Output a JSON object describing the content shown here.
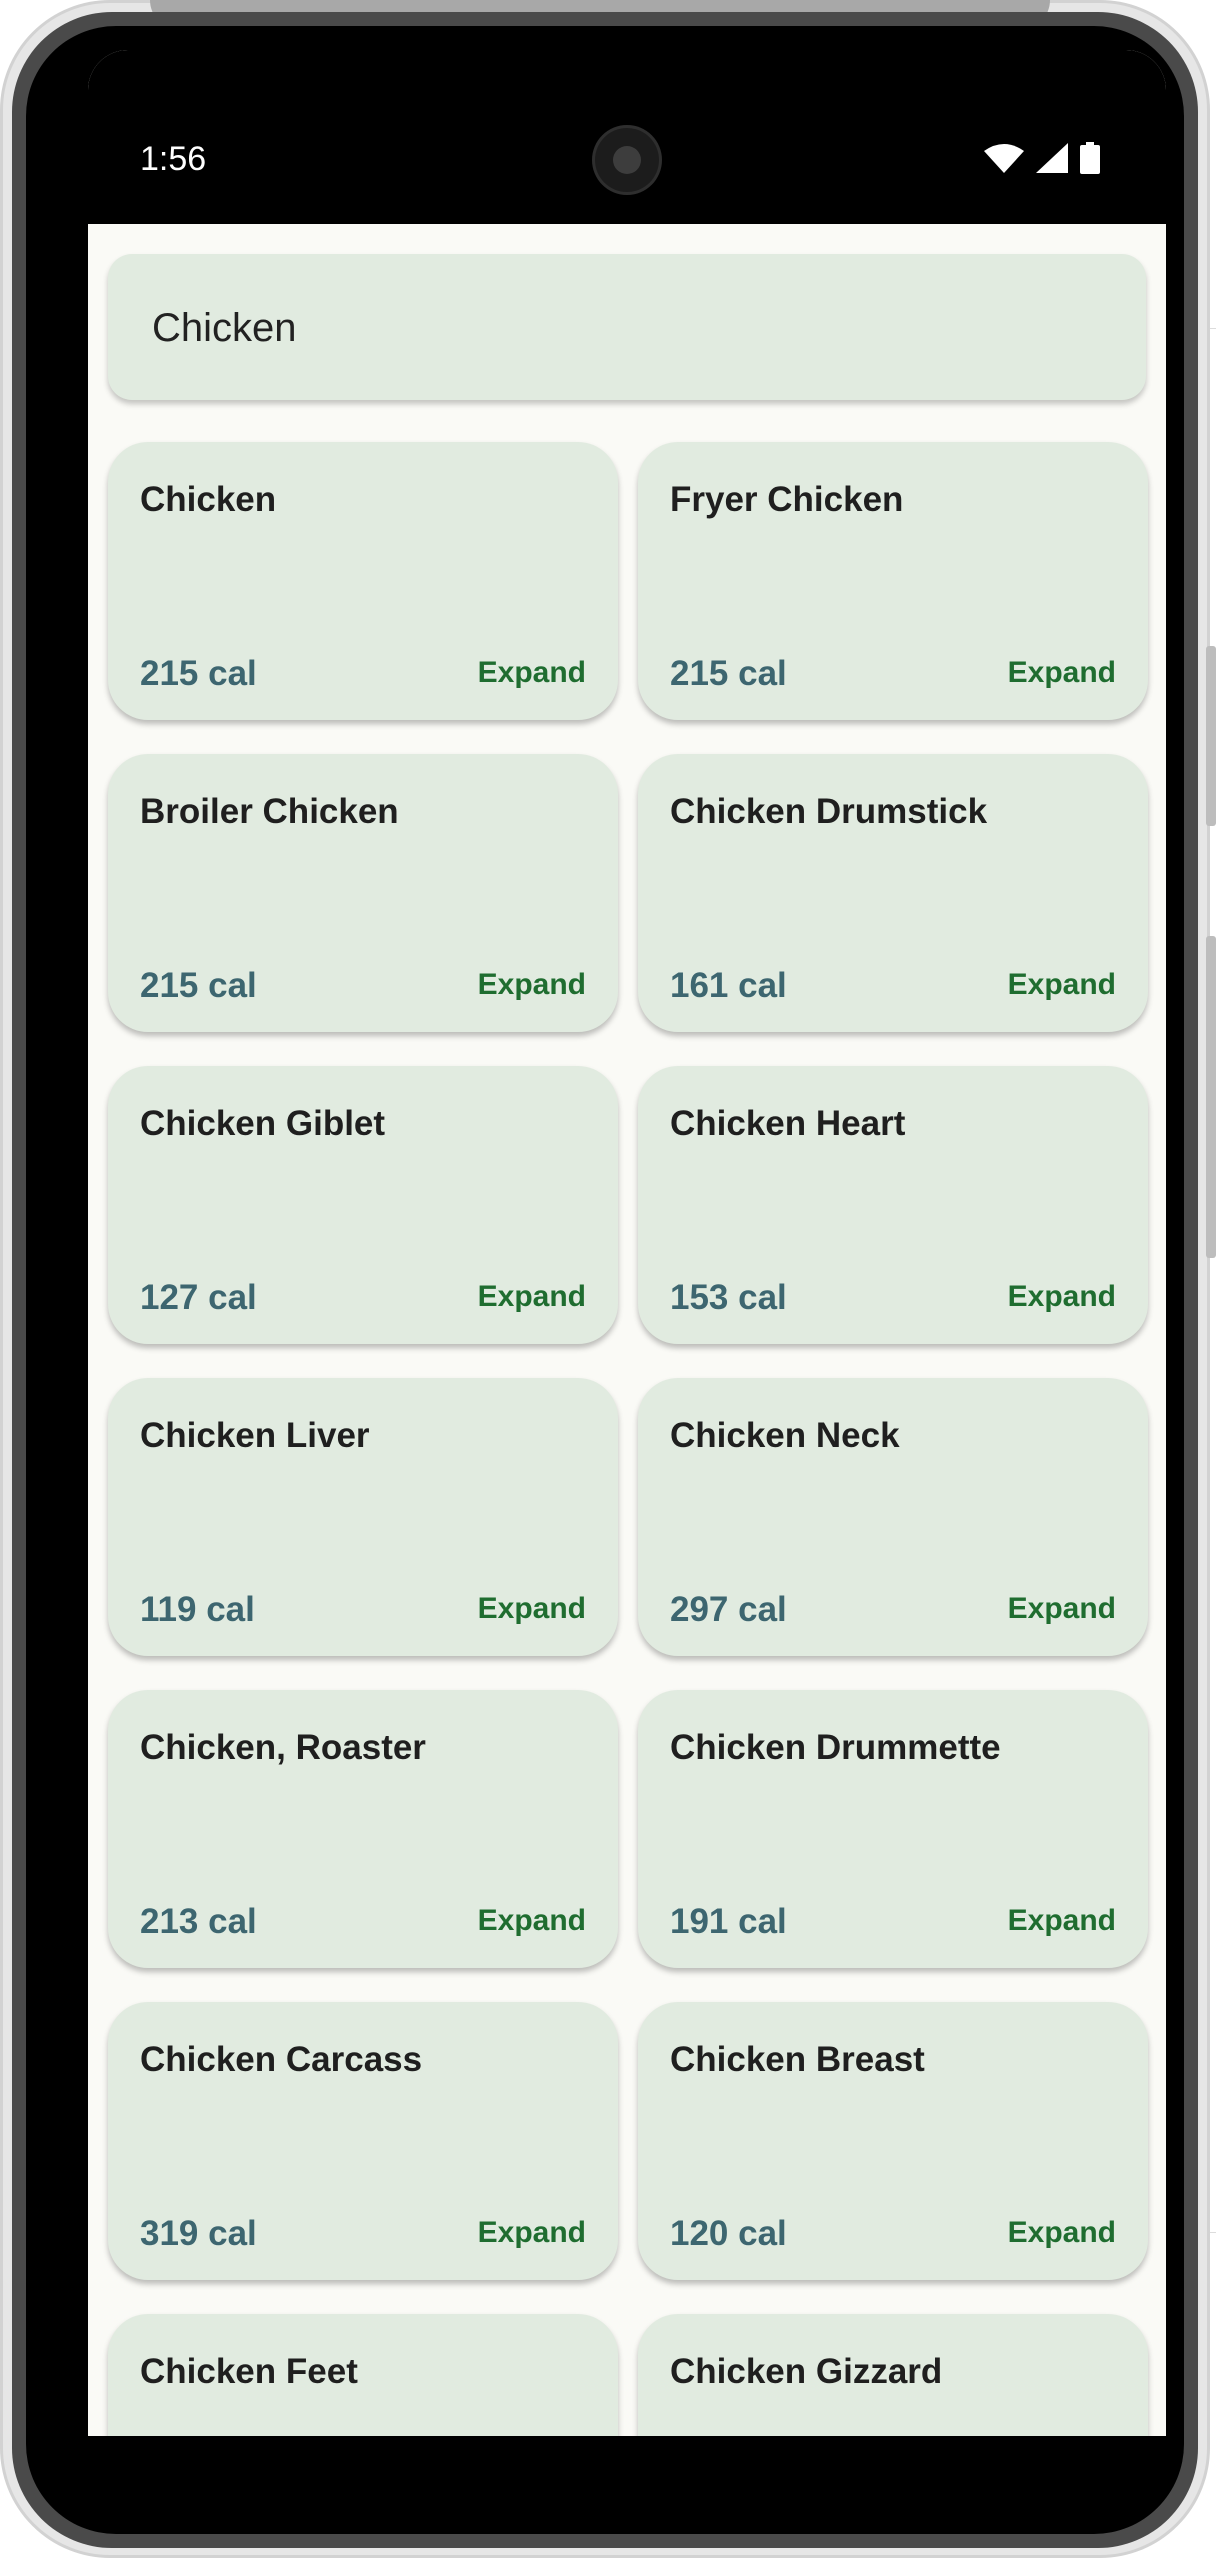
{
  "status_bar": {
    "time": "1:56",
    "icons": [
      "wifi-icon",
      "cell-signal-icon",
      "battery-icon"
    ]
  },
  "search": {
    "value": "Chicken"
  },
  "expand_label": "Expand",
  "foods": [
    {
      "name": "Chicken",
      "calories": "215 cal"
    },
    {
      "name": "Fryer Chicken",
      "calories": "215 cal"
    },
    {
      "name": "Broiler Chicken",
      "calories": "215 cal"
    },
    {
      "name": "Chicken Drumstick",
      "calories": "161 cal"
    },
    {
      "name": "Chicken Giblet",
      "calories": "127 cal"
    },
    {
      "name": "Chicken Heart",
      "calories": "153 cal"
    },
    {
      "name": "Chicken Liver",
      "calories": "119 cal"
    },
    {
      "name": "Chicken Neck",
      "calories": "297 cal"
    },
    {
      "name": "Chicken, Roaster",
      "calories": "213 cal"
    },
    {
      "name": "Chicken Drummette",
      "calories": "191 cal"
    },
    {
      "name": "Chicken Carcass",
      "calories": "319 cal"
    },
    {
      "name": "Chicken Breast",
      "calories": "120 cal"
    },
    {
      "name": "Chicken Feet",
      "calories": ""
    },
    {
      "name": "Chicken Gizzard",
      "calories": ""
    }
  ],
  "colors": {
    "card_bg": "#e1ebe0",
    "screen_bg": "#fafaf6",
    "calorie_text": "#3d6670",
    "expand_text": "#1f6d30"
  }
}
